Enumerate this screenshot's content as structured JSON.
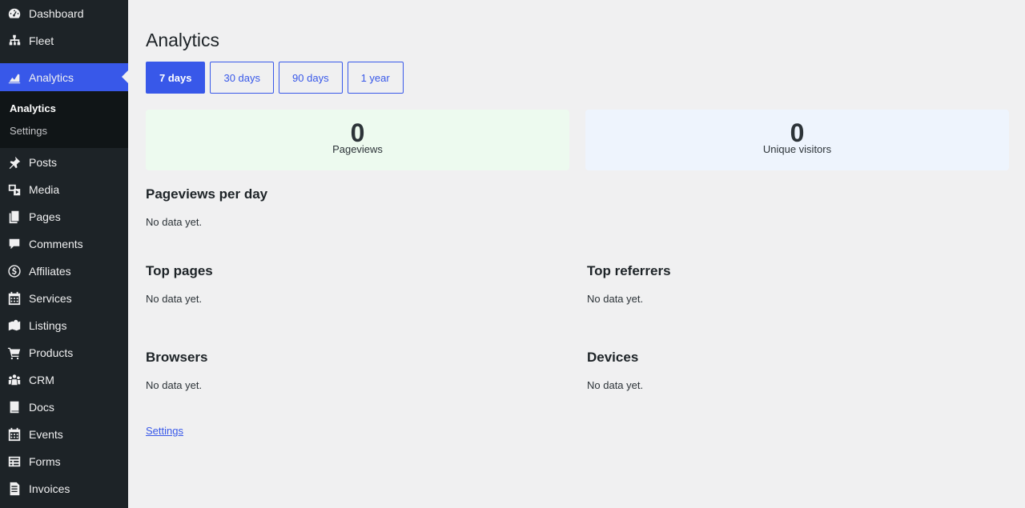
{
  "sidebar": {
    "items": [
      {
        "label": "Dashboard",
        "icon": "dashboard-icon"
      },
      {
        "label": "Fleet",
        "icon": "sitemap-icon"
      },
      {
        "label": "Analytics",
        "icon": "chart-icon"
      },
      {
        "label": "Posts",
        "icon": "pin-icon"
      },
      {
        "label": "Media",
        "icon": "media-icon"
      },
      {
        "label": "Pages",
        "icon": "pages-icon"
      },
      {
        "label": "Comments",
        "icon": "comment-icon"
      },
      {
        "label": "Affiliates",
        "icon": "dollar-icon"
      },
      {
        "label": "Services",
        "icon": "calendar-icon"
      },
      {
        "label": "Listings",
        "icon": "map-icon"
      },
      {
        "label": "Products",
        "icon": "cart-icon"
      },
      {
        "label": "CRM",
        "icon": "groups-icon"
      },
      {
        "label": "Docs",
        "icon": "book-icon"
      },
      {
        "label": "Events",
        "icon": "calendar-icon"
      },
      {
        "label": "Forms",
        "icon": "forms-icon"
      },
      {
        "label": "Invoices",
        "icon": "invoice-icon"
      }
    ],
    "submenu": [
      {
        "label": "Analytics"
      },
      {
        "label": "Settings"
      }
    ]
  },
  "main": {
    "title": "Analytics",
    "ranges": [
      "7 days",
      "30 days",
      "90 days",
      "1 year"
    ],
    "active_range": "7 days",
    "stats": [
      {
        "value": "0",
        "label": "Pageviews"
      },
      {
        "value": "0",
        "label": "Unique visitors"
      }
    ],
    "sections": {
      "pageviews_per_day": {
        "title": "Pageviews per day",
        "empty": "No data yet."
      },
      "top_pages": {
        "title": "Top pages",
        "empty": "No data yet."
      },
      "top_referrers": {
        "title": "Top referrers",
        "empty": "No data yet."
      },
      "browsers": {
        "title": "Browsers",
        "empty": "No data yet."
      },
      "devices": {
        "title": "Devices",
        "empty": "No data yet."
      }
    },
    "settings_link": "Settings"
  },
  "colors": {
    "accent": "#3858e9",
    "sidebar_bg": "#1d2327",
    "submenu_bg": "#101517",
    "page_bg": "#f0f0f1",
    "pageviews_card": "#edfaef",
    "visitors_card": "#eef4fd"
  }
}
